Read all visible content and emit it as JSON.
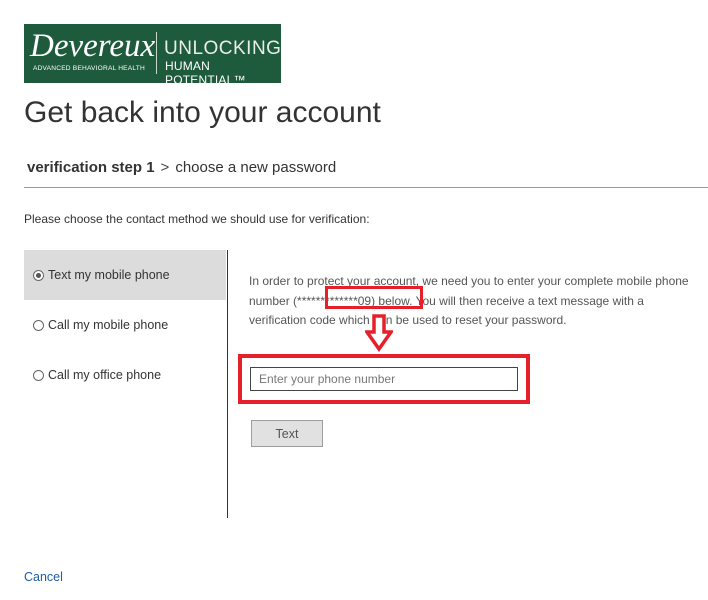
{
  "logo": {
    "brand": "Devereux",
    "subtitle": "ADVANCED BEHAVIORAL HEALTH",
    "tagline_line1": "UNLOCKING",
    "tagline_line2": "HUMAN POTENTIAL™"
  },
  "page_title": "Get back into your account",
  "breadcrumb": {
    "current_step": "verification step 1",
    "separator": ">",
    "next_step": "choose a new password"
  },
  "instruction": "Please choose the contact method we should use for verification:",
  "options": [
    {
      "label": "Text my mobile phone",
      "selected": true
    },
    {
      "label": "Call my mobile phone",
      "selected": false
    },
    {
      "label": "Call my office phone",
      "selected": false
    }
  ],
  "description": {
    "part1": "In order to protect your account, we need you to enter your complete mobile phone number ",
    "masked_number": "(*************09)",
    "part2": " below. You will then receive a text message with a verification code which can be used to reset your password."
  },
  "phone_input": {
    "placeholder": "Enter your phone number",
    "value": ""
  },
  "text_button_label": "Text",
  "cancel_label": "Cancel",
  "colors": {
    "logo_green": "#1e5a3c",
    "annotation_red": "#e5202b",
    "link_blue": "#1a5da8",
    "selected_bg": "#dcdcdc"
  }
}
